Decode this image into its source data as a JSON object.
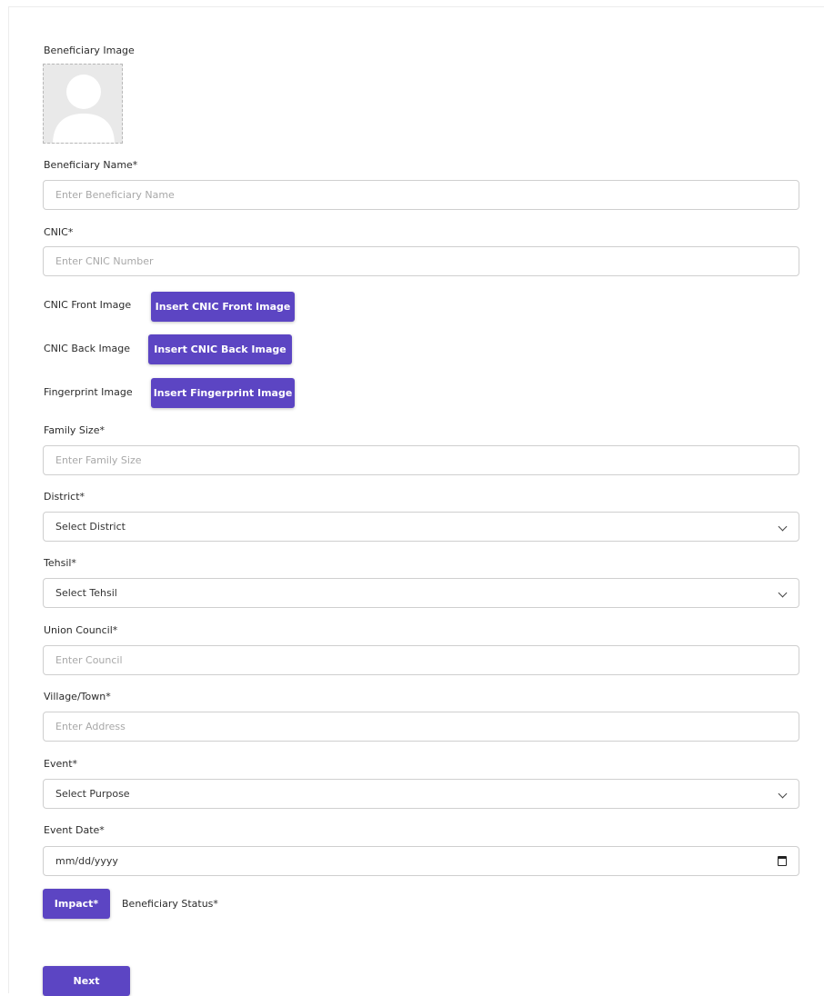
{
  "form": {
    "beneficiary_image_label": "Beneficiary Image",
    "name_label": "Beneficiary Name*",
    "name_placeholder": "Enter Beneficiary Name",
    "cnic_label": "CNIC*",
    "cnic_placeholder": "Enter CNIC Number",
    "cnic_front_label": "CNIC Front Image",
    "cnic_front_button": "Insert CNIC Front Image",
    "cnic_back_label": "CNIC Back Image",
    "cnic_back_button": "Insert CNIC Back Image",
    "fingerprint_label": "Fingerprint Image",
    "fingerprint_button": "Insert Fingerprint Image",
    "family_size_label": "Family Size*",
    "family_size_placeholder": "Enter Family Size",
    "district_label": "District*",
    "district_value": "Select District",
    "tehsil_label": "Tehsil*",
    "tehsil_value": "Select Tehsil",
    "union_council_label": "Union Council*",
    "union_council_placeholder": "Enter Council",
    "village_label": "Village/Town*",
    "village_placeholder": "Enter Address",
    "event_label": "Event*",
    "event_value": "Select Purpose",
    "event_date_label": "Event Date*",
    "event_date_placeholder": "mm/dd/yyyy",
    "impact_button": "Impact*",
    "beneficiary_status_label": "Beneficiary Status*",
    "next_button": "Next"
  },
  "colors": {
    "primary": "#5c45c3",
    "border": "#cfcfcf",
    "placeholder": "#a8a8a8"
  },
  "icons": [
    "avatar-placeholder-icon",
    "chevron-down-icon",
    "calendar-icon"
  ]
}
